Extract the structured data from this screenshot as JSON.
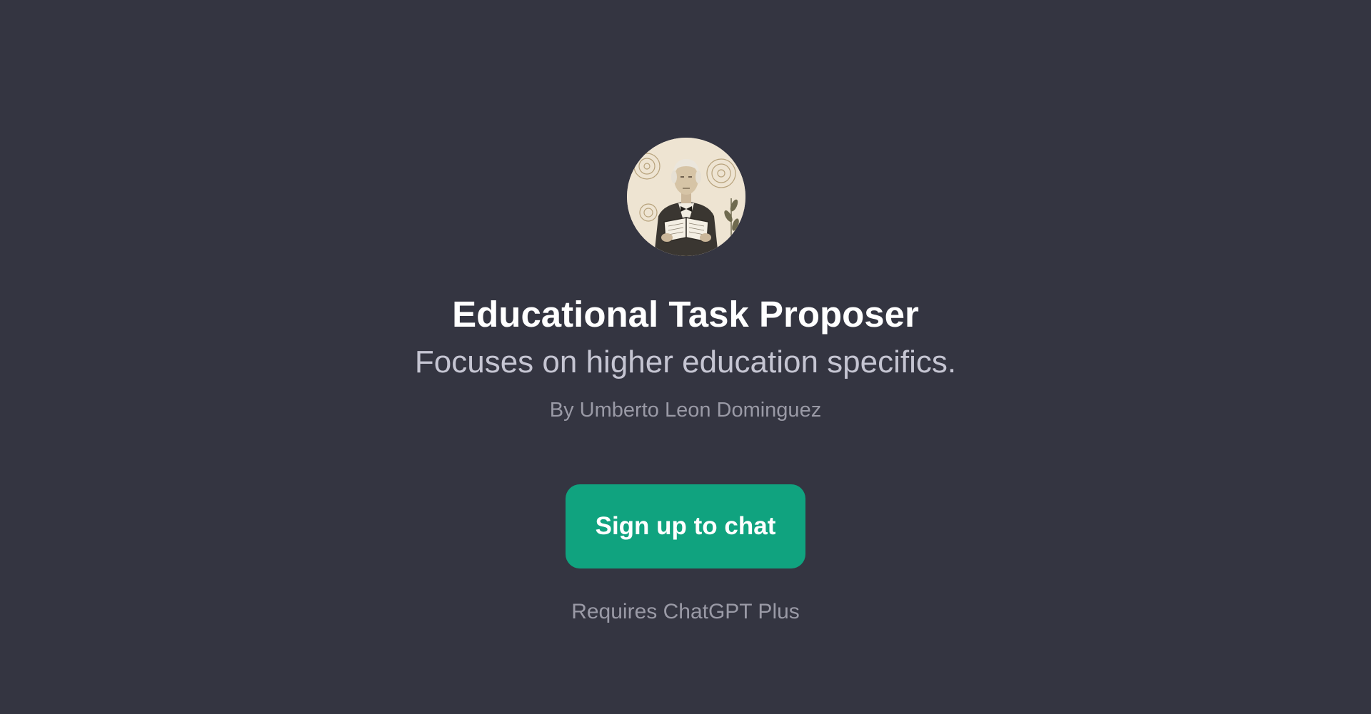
{
  "gpt": {
    "avatar_icon": "professor-portrait-icon",
    "title": "Educational Task Proposer",
    "description": "Focuses on higher education specifics.",
    "author": "By Umberto Leon Dominguez"
  },
  "actions": {
    "signup_label": "Sign up to chat",
    "requirement_note": "Requires ChatGPT Plus"
  },
  "colors": {
    "background": "#343541",
    "accent": "#10a37f",
    "title_text": "#ffffff",
    "muted_text": "#9a9aa6"
  }
}
